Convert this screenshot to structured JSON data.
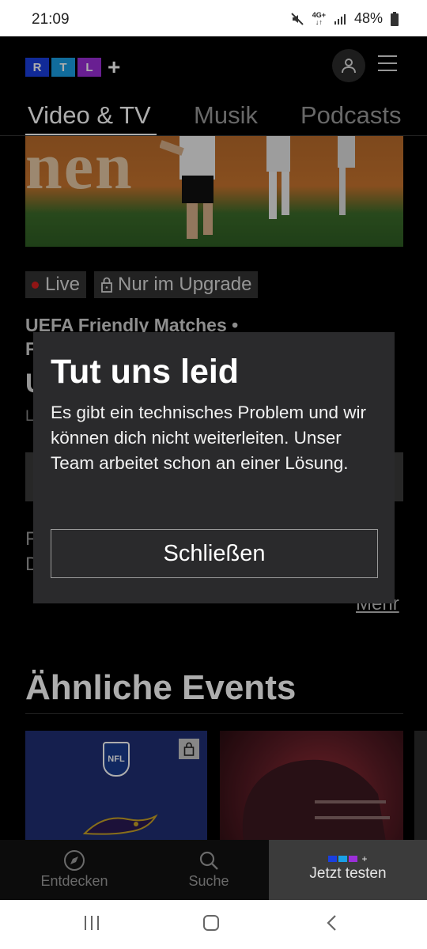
{
  "status_bar": {
    "time": "21:09",
    "battery": "48%",
    "network": "4G+"
  },
  "header": {
    "logo_letters": [
      "R",
      "T",
      "L"
    ],
    "logo_colors": [
      "#1a3fe0",
      "#1aa0e6",
      "#9b2fd8"
    ],
    "logo_plus": "+"
  },
  "tabs": [
    {
      "label": "Video & TV",
      "active": true
    },
    {
      "label": "Musik",
      "active": false
    },
    {
      "label": "Podcasts",
      "active": false
    }
  ],
  "content": {
    "hero_text": "nen",
    "badge_live": "Live",
    "badge_upgrade": "Nur im Upgrade",
    "event_title_line1": "UEFA Friendly Matches •",
    "event_title_line2": "F",
    "fragment_u": "U",
    "fragment_l": "L",
    "fragment_f": "F",
    "fragment_d": "D",
    "more_link": "Mehr",
    "section_title": "Ähnliche Events",
    "card1_logo": "NFL"
  },
  "modal": {
    "title": "Tut uns leid",
    "message": "Es gibt ein technisches Problem und wir können dich nicht weiterleiten. Unser Team arbeitet schon an einer Lösung.",
    "close_label": "Schließen"
  },
  "bottom_nav": {
    "explore_label": "Entdecken",
    "search_label": "Suche",
    "trial_label": "Jetzt testen"
  },
  "colors": {
    "live_dot": "#d62020",
    "modal_bg": "#2a2a2c",
    "trial_bg": "#3b3b3b"
  }
}
